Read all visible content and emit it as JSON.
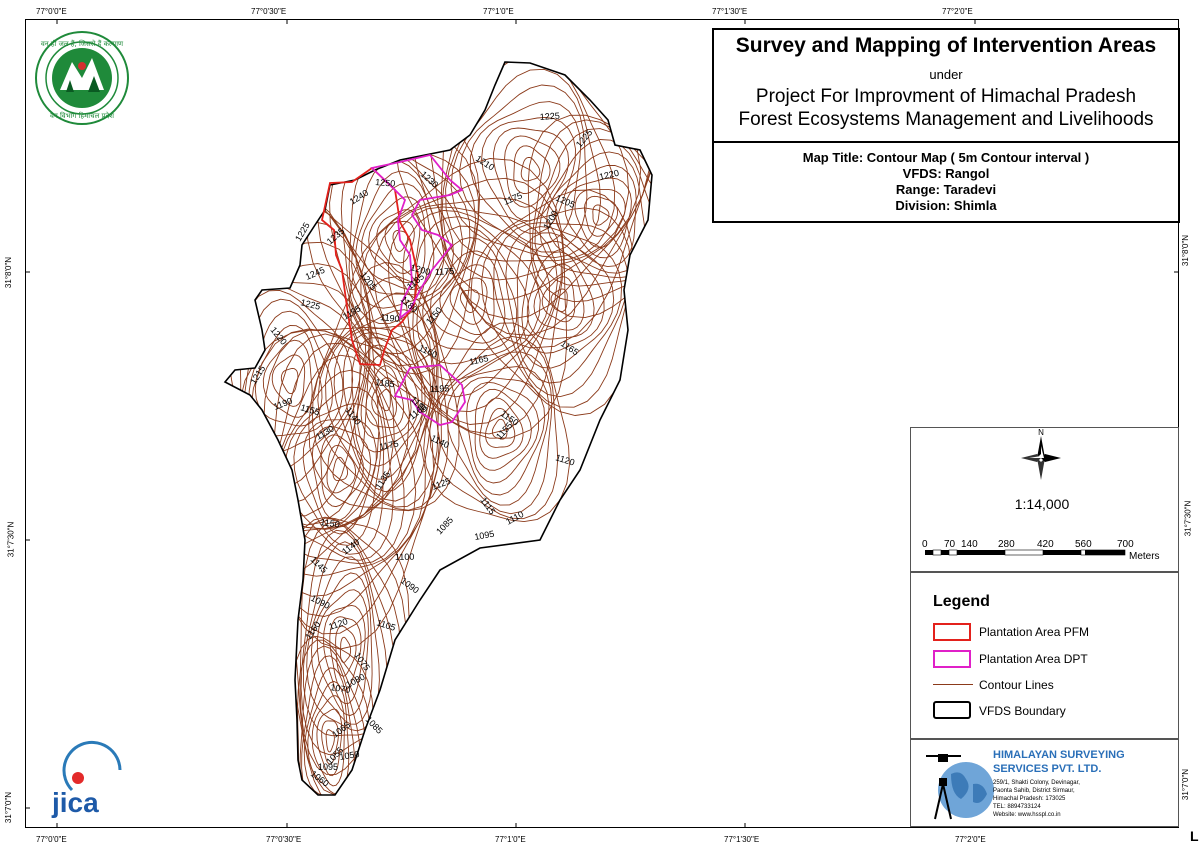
{
  "coords": {
    "top": [
      "77°0'0\"E",
      "77°0'30\"E",
      "77°1'0\"E",
      "77°1'30\"E",
      "77°2'0\"E"
    ],
    "bottom": [
      "77°0'0\"E",
      "77°0'30\"E",
      "77°1'0\"E",
      "77°1'30\"E",
      "77°2'0\"E"
    ],
    "left": [
      "31°8'0\"N",
      "31°7'30\"N",
      "31°7'0\"N"
    ],
    "right": [
      "31°8'0\"N",
      "31°7'30\"N",
      "31°7'0\"N"
    ]
  },
  "title_box": {
    "main": "Survey and Mapping of Intervention Areas",
    "under": "under",
    "project_line1": "Project For Improvment of Himachal Pradesh",
    "project_line2": "Forest Ecosystems Management and Livelihoods",
    "map_title": "Map Title: Contour Map ( 5m Contour interval )",
    "vfds": "VFDS: Rangol",
    "range": "Range: Taradevi",
    "division": "Division: Shimla"
  },
  "north_arrow": {
    "label": "N"
  },
  "scale": {
    "ratio": "1:14,000",
    "ticks": [
      "0",
      "70",
      "140",
      "280",
      "420",
      "560",
      "700"
    ],
    "unit": "Meters"
  },
  "legend": {
    "title": "Legend",
    "items": [
      {
        "label": "Plantation Area PFM",
        "color": "#e3211c"
      },
      {
        "label": "Plantation Area DPT",
        "color": "#e020c8"
      },
      {
        "label": "Contour Lines",
        "color": "#8b3a1a"
      },
      {
        "label": "VFDS Boundary",
        "color": "#000000"
      }
    ]
  },
  "company": {
    "name_line1": "HIMALAYAN SURVEYING",
    "name_line2": "SERVICES PVT. LTD.",
    "address": [
      "259/1, Shakti Colony, Devinagar,",
      "Paonta Sahib, District Sirmaur,",
      "Himachal Pradesh: 173025",
      "TEL: 8894733124",
      "Website: www.hsspl.co.in"
    ]
  },
  "logos": {
    "top_left_text_top": "वन ही जल हैं, जिससे हैं कल्याण",
    "top_left_text_bottom": "वन विभाग हिमाचल प्रदेश",
    "jica": "jica"
  },
  "contour_labels": [
    "1225",
    "1245",
    "1225",
    "1220",
    "1240",
    "1250",
    "1230",
    "1235",
    "1225",
    "1210",
    "1225",
    "1220",
    "1205",
    "1200",
    "1175",
    "1200",
    "1205",
    "1195",
    "1190",
    "1180",
    "1185",
    "1175",
    "1165",
    "1150",
    "1165",
    "1160",
    "1215",
    "1190",
    "1155",
    "1140",
    "1130",
    "1185",
    "1190",
    "1160",
    "1195",
    "1150",
    "1155",
    "1175",
    "1140",
    "1135",
    "1125",
    "1120",
    "1115",
    "1110",
    "1150",
    "1145",
    "1140",
    "1100",
    "1090",
    "1085",
    "1095",
    "1090",
    "1160",
    "1120",
    "1105",
    "1075",
    "1080",
    "1070",
    "1085",
    "1065",
    "1095",
    "1060",
    "1055",
    "1050"
  ],
  "colors": {
    "contour": "#8b3a1a",
    "pfm": "#e3211c",
    "dpt": "#e020c8",
    "boundary": "#000000"
  }
}
